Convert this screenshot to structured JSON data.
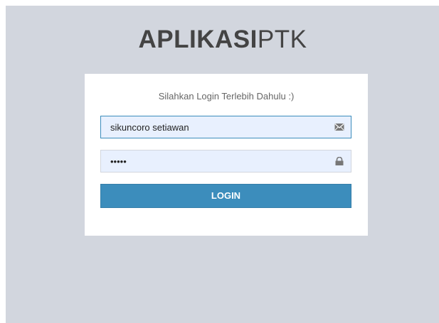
{
  "brand": {
    "bold": "APLIKASI",
    "light": "PTK"
  },
  "login": {
    "message": "Silahkan Login Terlebih Dahulu :)",
    "username_value": "sikuncoro setiawan",
    "password_value": "•••••",
    "button_label": "LOGIN"
  },
  "icons": {
    "username": "envelope-icon",
    "password": "lock-icon"
  },
  "colors": {
    "background": "#d2d6de",
    "primary": "#3c8dbc",
    "input_fill": "#e8f0fe"
  }
}
